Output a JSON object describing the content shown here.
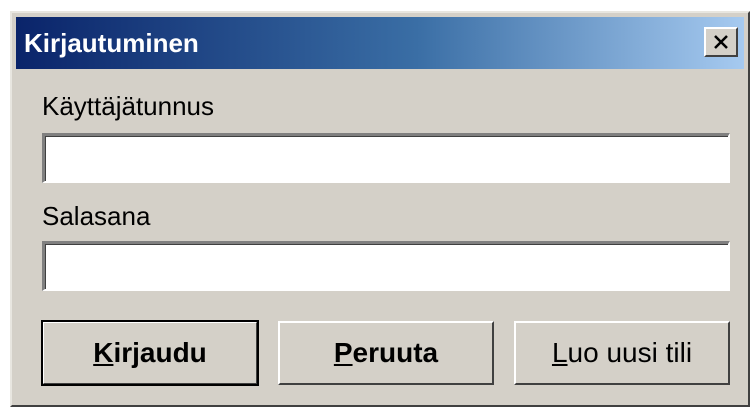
{
  "dialog": {
    "title": "Kirjautuminen",
    "close_icon": "close-icon"
  },
  "form": {
    "username_label": "Käyttäjätunnus",
    "username_value": "",
    "password_label": "Salasana",
    "password_value": ""
  },
  "buttons": {
    "login": {
      "mnemonic": "K",
      "rest": "irjaudu"
    },
    "cancel": {
      "mnemonic": "P",
      "rest": "eruuta"
    },
    "create": {
      "mnemonic": "L",
      "rest": "uo uusi tili"
    }
  },
  "colors": {
    "titlebar_start": "#0a246a",
    "titlebar_end": "#a6caf0",
    "dialog_bg": "#d4d0c8"
  }
}
